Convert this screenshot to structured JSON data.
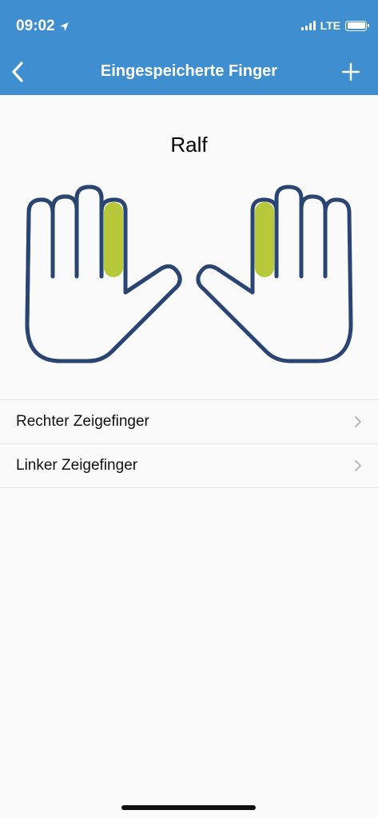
{
  "status_bar": {
    "time": "09:02",
    "network": "LTE",
    "location_icon": "location-arrow-icon",
    "signal_icon": "signal-bars-icon",
    "battery_icon": "battery-icon"
  },
  "nav": {
    "title": "Eingespeicherte Finger",
    "back_icon": "chevron-left-icon",
    "add_icon": "plus-icon"
  },
  "user": {
    "name": "Ralf"
  },
  "hands": {
    "left_hand_icon": "left-hand-icon",
    "right_hand_icon": "right-hand-icon",
    "highlighted_fingers": [
      "left-index",
      "right-index"
    ]
  },
  "fingers": [
    {
      "label": "Rechter Zeigefinger"
    },
    {
      "label": "Linker Zeigefinger"
    }
  ],
  "colors": {
    "header_bg": "#3f8fd0",
    "hand_outline": "#2b4573",
    "highlight": "#b7c93a",
    "background": "#fafafa"
  }
}
